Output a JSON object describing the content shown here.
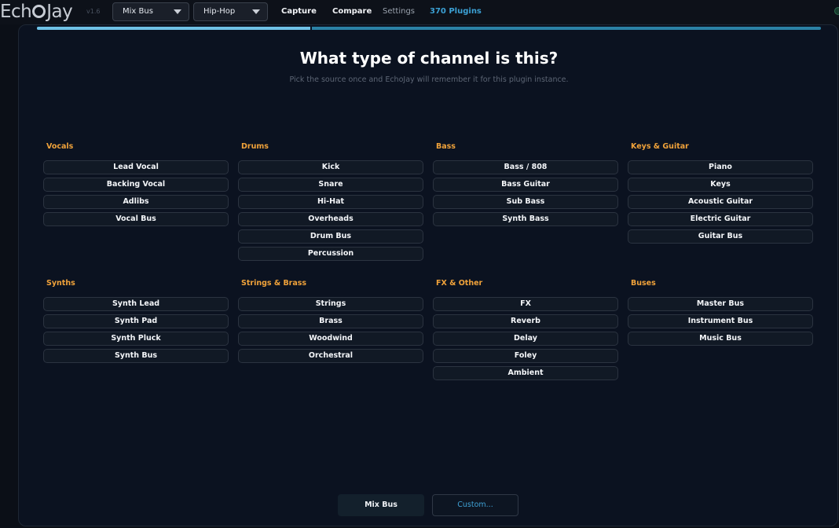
{
  "header": {
    "logo_prefix": "Ech",
    "logo_suffix": "Jay",
    "version": "v1.6",
    "channel_select": "Mix Bus",
    "genre_select": "Hip-Hop",
    "nav": {
      "capture": "Capture",
      "compare": "Compare",
      "settings": "Settings",
      "plugins": "370 Plugins"
    }
  },
  "wizard": {
    "progress_fraction": 0.35,
    "title": "What type of channel is this?",
    "subtitle": "Pick the source once and EchoJay will remember it for this plugin instance."
  },
  "groups": [
    {
      "title": "Vocals",
      "options": [
        "Lead Vocal",
        "Backing Vocal",
        "Adlibs",
        "Vocal Bus"
      ]
    },
    {
      "title": "Drums",
      "options": [
        "Kick",
        "Snare",
        "Hi-Hat",
        "Overheads",
        "Drum Bus",
        "Percussion"
      ]
    },
    {
      "title": "Bass",
      "options": [
        "Bass / 808",
        "Bass Guitar",
        "Sub Bass",
        "Synth Bass"
      ]
    },
    {
      "title": "Keys & Guitar",
      "options": [
        "Piano",
        "Keys",
        "Acoustic Guitar",
        "Electric Guitar",
        "Guitar Bus"
      ]
    },
    {
      "title": "Synths",
      "options": [
        "Synth Lead",
        "Synth Pad",
        "Synth Pluck",
        "Synth Bus"
      ]
    },
    {
      "title": "Strings & Brass",
      "options": [
        "Strings",
        "Brass",
        "Woodwind",
        "Orchestral"
      ]
    },
    {
      "title": "FX & Other",
      "options": [
        "FX",
        "Reverb",
        "Delay",
        "Foley",
        "Ambient"
      ]
    },
    {
      "title": "Buses",
      "options": [
        "Master Bus",
        "Instrument Bus",
        "Music Bus"
      ]
    }
  ],
  "footer": {
    "mix_bus": "Mix Bus",
    "custom": "Custom..."
  },
  "colors": {
    "accent": "#3ba0d4",
    "category": "#f0a23a",
    "panel": "#0b1220"
  }
}
